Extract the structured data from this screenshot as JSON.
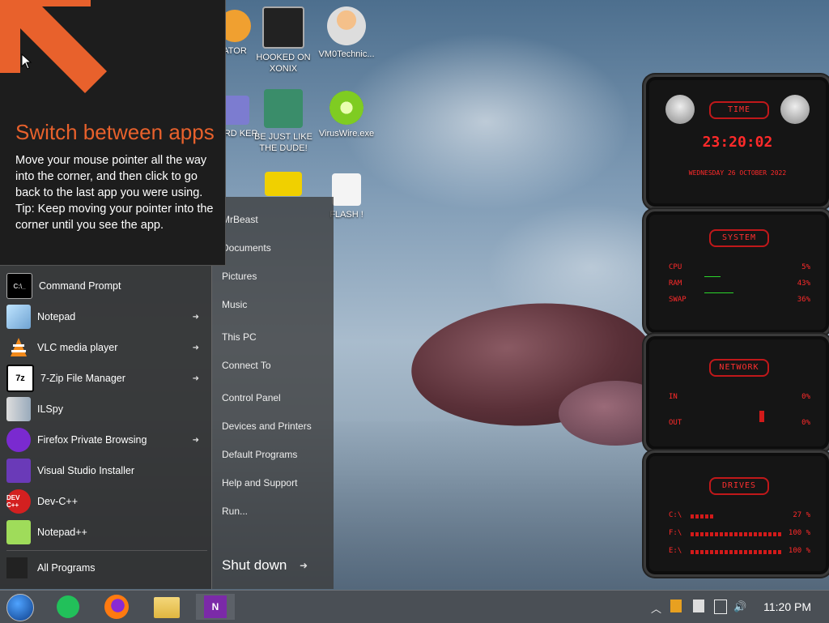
{
  "tip": {
    "title": "Switch between apps",
    "body": "Move your mouse pointer all the way into the corner, and then click to go back to the last app you were using.",
    "tip": "Tip: Keep moving your pointer into the corner until you see the app."
  },
  "desktop_icons": [
    {
      "label": "ATOR",
      "icon": "app-icon"
    },
    {
      "label": "HOOKED ON XONIX",
      "icon": "game-icon"
    },
    {
      "label": "VM0Technic...",
      "icon": "doctor-icon"
    },
    {
      "label": "CARD KER",
      "icon": "card-icon"
    },
    {
      "label": "BE JUST LIKE THE DUDE!",
      "icon": "elf-icon"
    },
    {
      "label": "VirusWire.exe",
      "icon": "lime-icon"
    },
    {
      "label": "FLASH !",
      "icon": "flash-icon"
    }
  ],
  "start_menu": {
    "programs": [
      {
        "label": "Command Prompt",
        "icon": "cmd-icon",
        "submenu": false
      },
      {
        "label": "Notepad",
        "icon": "notepad-icon",
        "submenu": true
      },
      {
        "label": "VLC media player",
        "icon": "vlc-icon",
        "submenu": true
      },
      {
        "label": "7-Zip File Manager",
        "icon": "7zip-icon",
        "submenu": true
      },
      {
        "label": "ILSpy",
        "icon": "ilspy-icon",
        "submenu": false
      },
      {
        "label": "Firefox Private Browsing",
        "icon": "firefox-private-icon",
        "submenu": true
      },
      {
        "label": "Visual Studio Installer",
        "icon": "vs-installer-icon",
        "submenu": false
      },
      {
        "label": "Dev-C++",
        "icon": "devcpp-icon",
        "submenu": false
      },
      {
        "label": "Notepad++",
        "icon": "notepadpp-icon",
        "submenu": false
      }
    ],
    "all_programs": "All Programs",
    "right_links": [
      "MrBeast",
      "Documents",
      "Pictures",
      "Music",
      "This PC",
      "Connect To",
      "Control Panel",
      "Devices and Printers",
      "Default Programs",
      "Help and Support",
      "Run..."
    ],
    "shutdown": "Shut down",
    "submenu_arrow": "➜"
  },
  "widgets": {
    "time": {
      "title": "TIME",
      "clock": "23:20:02",
      "date": "WEDNESDAY 26 OCTOBER 2022"
    },
    "system": {
      "title": "SYSTEM",
      "rows": [
        {
          "label": "CPU",
          "value": "5%"
        },
        {
          "label": "RAM",
          "value": "43%"
        },
        {
          "label": "SWAP",
          "value": "36%"
        }
      ]
    },
    "network": {
      "title": "NETWORK",
      "rows": [
        {
          "label": "IN",
          "value": "0%"
        },
        {
          "label": "OUT",
          "value": "0%"
        }
      ]
    },
    "drives": {
      "title": "DRIVES",
      "rows": [
        {
          "label": "C:\\",
          "value": "27 %"
        },
        {
          "label": "F:\\",
          "value": "100 %"
        },
        {
          "label": "E:\\",
          "value": "100 %"
        }
      ]
    }
  },
  "taskbar": {
    "apps": [
      "start-orb-icon",
      "green-chat-icon",
      "firefox-icon",
      "file-explorer-icon",
      "onenote-icon"
    ],
    "clock": "11:20 PM",
    "tray": [
      "chevron-up-icon",
      "flag-icon",
      "flag-error-icon",
      "network-icon",
      "volume-icon"
    ]
  },
  "colors": {
    "accent": "#e8612c",
    "widget_red": "#ff2a2a",
    "taskbar": "#4a4f55"
  }
}
